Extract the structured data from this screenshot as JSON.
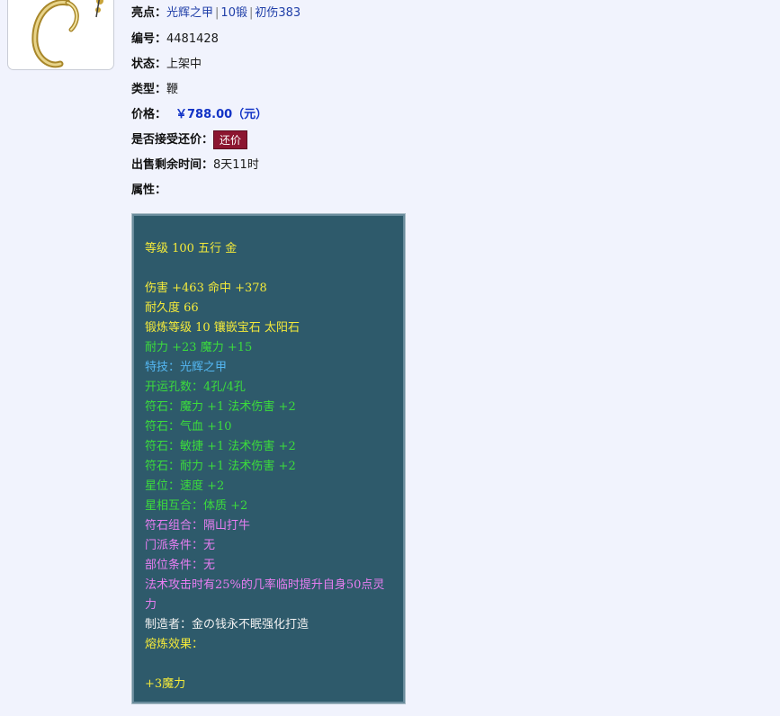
{
  "item": {
    "highlight_label": "亮点：",
    "highlight_tags": [
      "光辉之甲",
      "10锻",
      "初伤383"
    ],
    "id_label": "编号：",
    "id_value": "4481428",
    "status_label": "状态：",
    "status_value": "上架中",
    "type_label": "类型：",
    "type_value": "鞭",
    "price_label": "价格：",
    "price_value": "￥788.00（元）",
    "bargain_label": "是否接受还价：",
    "bargain_button": "还价",
    "time_label": "出售剩余时间：",
    "time_value": "8天11时",
    "attr_label": "属性："
  },
  "attributes": {
    "level": "等级 100 五行 金",
    "damage": "伤害 +463 命中 +378",
    "durability": "耐久度 66",
    "forge": "锻炼等级 10 镶嵌宝石 太阳石",
    "stats": "耐力 +23 魔力 +15",
    "special_skill": "特技：光辉之甲",
    "holes": "开运孔数：4孔/4孔",
    "rune1": "符石：魔力 +1 法术伤害 +2",
    "rune2": "符石：气血 +10",
    "rune3": "符石：敏捷 +1 法术伤害 +2",
    "rune4": "符石：耐力 +1 法术伤害 +2",
    "star_position": "星位：速度 +2",
    "star_match": "星相互合：体质 +2",
    "rune_combo": "符石组合：隔山打牛",
    "school_req": "门派条件：无",
    "slot_req": "部位条件：无",
    "effect": "法术攻击时有25%的几率临时提升自身50点灵力",
    "maker": "制造者：金の钱永不眠强化打造",
    "smelt_label": "熔炼效果：",
    "smelt_value": "+3魔力"
  },
  "colors": {
    "background": "#f1f3fd",
    "link": "#1f3ea8",
    "price": "#1233c6",
    "bargain_button": "#8c1630",
    "attr_bg": "#2e5a6b",
    "yellow": "#f4ea3a",
    "green": "#3cdc3c",
    "blue": "#54b7f2",
    "pink": "#e87ef2"
  }
}
